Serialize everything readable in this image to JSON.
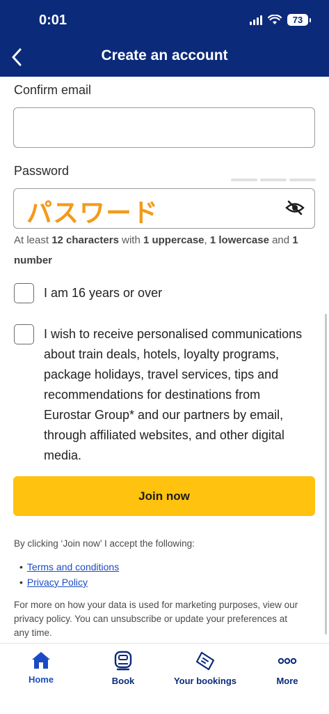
{
  "status_bar": {
    "time": "0:01",
    "battery": "73"
  },
  "header": {
    "title": "Create an account",
    "back_icon": "chevron-left-icon"
  },
  "form": {
    "confirm_email": {
      "label": "Confirm email",
      "value": ""
    },
    "password": {
      "label": "Password",
      "value": "パスワード",
      "visibility_icon": "eye-off-icon"
    },
    "password_hint": {
      "p1": "At least ",
      "b1": "12 characters",
      "p2": " with ",
      "b2": "1 uppercase",
      "p3": ", ",
      "b3": "1 lowercase",
      "p4": " and ",
      "b4": "1 number"
    },
    "age_checkbox": {
      "label": "I am 16 years or over",
      "checked": false
    },
    "marketing_checkbox": {
      "lines": [
        "I wish to receive personalised communications",
        "about train deals, hotels, loyalty programs,",
        "package holidays, travel services, tips and",
        "recommendations for destinations from",
        "Eurostar Group* and our partners by email,",
        "through affiliated websites, and other digital",
        "media."
      ],
      "checked": false
    },
    "join_button": "Join now"
  },
  "legal": {
    "intro": "By clicking ‘Join now’ I accept the following:",
    "links": [
      "Terms and conditions",
      "Privacy Policy"
    ],
    "footer_lines": [
      "For more on how your data is used for marketing purposes, view our",
      "privacy policy. You can unsubscribe or update your preferences at",
      "any time."
    ]
  },
  "tabbar": {
    "items": [
      {
        "label": "Home",
        "icon": "home-icon",
        "active": true
      },
      {
        "label": "Book",
        "icon": "train-icon",
        "active": false
      },
      {
        "label": "Your bookings",
        "icon": "ticket-icon",
        "active": false
      },
      {
        "label": "More",
        "icon": "more-dots-icon",
        "active": false
      }
    ]
  },
  "colors": {
    "brand_navy": "#0b2a7a",
    "accent_yellow": "#ffc20e",
    "link_blue": "#1b4bc4",
    "password_text": "#f39a1a"
  }
}
